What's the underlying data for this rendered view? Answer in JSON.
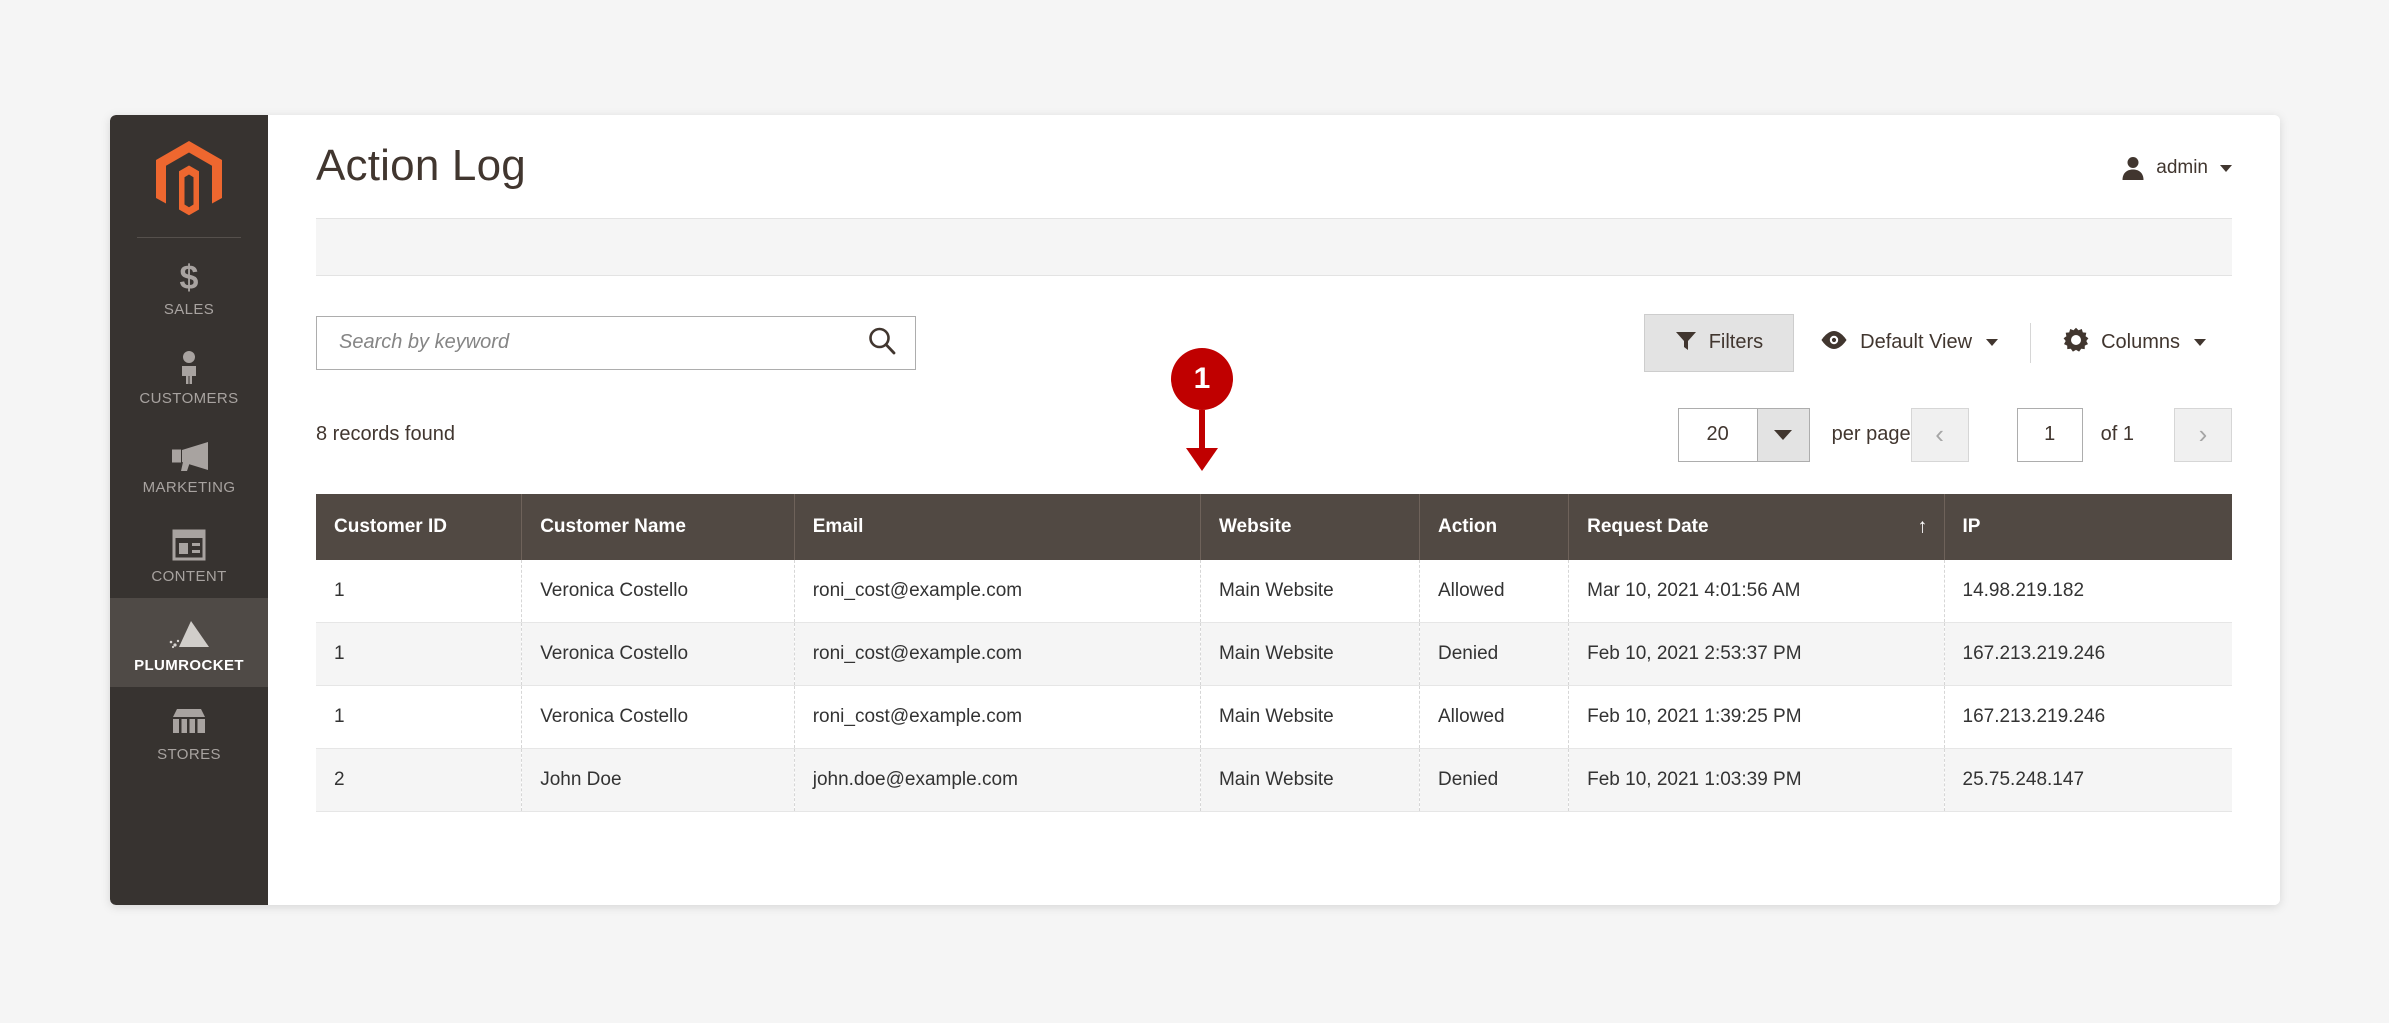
{
  "page": {
    "title": "Action Log",
    "messages_strip": ""
  },
  "user_menu": {
    "label": "admin",
    "icon": "person-icon",
    "caret": "chevron-down-icon"
  },
  "sidebar": {
    "logo": "magento-logo-icon",
    "items": [
      {
        "label": "SALES",
        "icon": "dollar-icon",
        "active": false
      },
      {
        "label": "CUSTOMERS",
        "icon": "person-icon",
        "active": false
      },
      {
        "label": "MARKETING",
        "icon": "megaphone-icon",
        "active": false
      },
      {
        "label": "CONTENT",
        "icon": "layout-icon",
        "active": false
      },
      {
        "label": "PLUMROCKET",
        "icon": "pyramid-icon",
        "active": true
      },
      {
        "label": "STORES",
        "icon": "storefront-icon",
        "active": false
      }
    ]
  },
  "toolbar": {
    "search_placeholder": "Search by keyword",
    "search_value": "",
    "search_icon": "search-icon",
    "filters_label": "Filters",
    "filters_icon": "funnel-icon",
    "view_label": "Default View",
    "view_icon": "eye-icon",
    "columns_label": "Columns",
    "columns_icon": "gear-icon"
  },
  "grid_summary": {
    "records_found": "8 records found",
    "per_page_value": "20",
    "per_page_label": "per page",
    "page_value": "1",
    "page_of": "of 1",
    "prev_label": "‹",
    "next_label": "›"
  },
  "table": {
    "sort_column": "Request Date",
    "sort_direction": "asc",
    "sort_arrow": "↑",
    "columns": [
      {
        "key": "customer_id",
        "label": "Customer ID"
      },
      {
        "key": "customer_name",
        "label": "Customer Name"
      },
      {
        "key": "email",
        "label": "Email"
      },
      {
        "key": "website",
        "label": "Website"
      },
      {
        "key": "action",
        "label": "Action"
      },
      {
        "key": "request_date",
        "label": "Request Date"
      },
      {
        "key": "ip",
        "label": "IP"
      }
    ],
    "rows": [
      {
        "customer_id": "1",
        "customer_name": "Veronica Costello",
        "email": "roni_cost@example.com",
        "website": "Main Website",
        "action": "Allowed",
        "request_date": "Mar 10, 2021 4:01:56 AM",
        "ip": "14.98.219.182"
      },
      {
        "customer_id": "1",
        "customer_name": "Veronica Costello",
        "email": "roni_cost@example.com",
        "website": "Main Website",
        "action": "Denied",
        "request_date": "Feb 10, 2021 2:53:37 PM",
        "ip": "167.213.219.246"
      },
      {
        "customer_id": "1",
        "customer_name": "Veronica Costello",
        "email": "roni_cost@example.com",
        "website": "Main Website",
        "action": "Allowed",
        "request_date": "Feb 10, 2021 1:39:25 PM",
        "ip": "167.213.219.246"
      },
      {
        "customer_id": "2",
        "customer_name": "John Doe",
        "email": "john.doe@example.com",
        "website": "Main Website",
        "action": "Denied",
        "request_date": "Feb 10, 2021 1:03:39 PM",
        "ip": "25.75.248.147"
      }
    ]
  },
  "annotations": [
    {
      "number": "1",
      "color": "#c00000",
      "points": "down"
    }
  ],
  "colors": {
    "sidebar_bg": "#373330",
    "sidebar_active_bg": "#4f4a46",
    "brand_orange": "#ee672f",
    "table_header_bg": "#514943",
    "page_bg": "#f5f5f5",
    "annotation_red": "#c00000"
  }
}
